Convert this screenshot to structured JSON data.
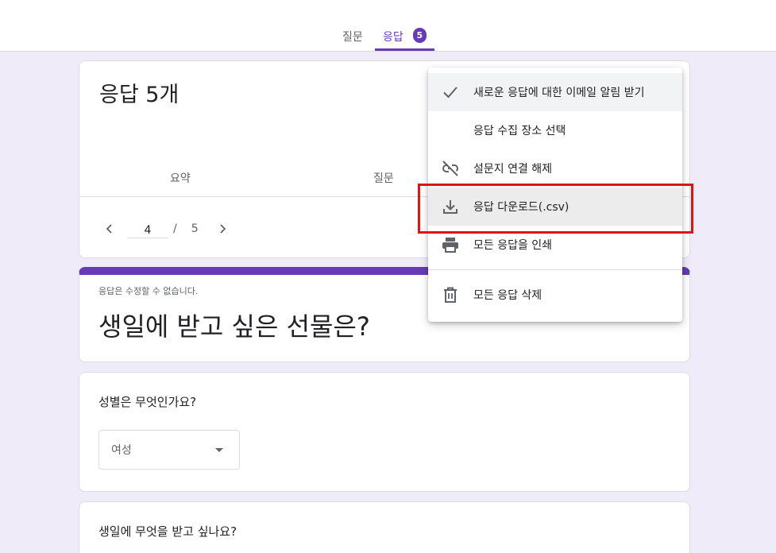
{
  "tabs": {
    "questions": "질문",
    "responses": "응답",
    "responses_count": "5"
  },
  "summary_card": {
    "response_count": "응답 5개",
    "subtabs": {
      "summary": "요약",
      "question": "질문"
    },
    "pager": {
      "current": "4",
      "separator": "/",
      "total": "5"
    }
  },
  "title_card": {
    "readonly_note": "응답은 수정할 수 없습니다.",
    "form_title": "생일에 받고 싶은 선물은?"
  },
  "question_1": {
    "label": "성별은 무엇인가요?",
    "selected": "여성"
  },
  "question_2": {
    "label": "생일에 무엇을 받고 싶나요?"
  },
  "menu": {
    "items": [
      {
        "label": "새로운 응답에 대한 이메일 알림 받기",
        "icon": "check-icon"
      },
      {
        "label": "응답 수집 장소 선택",
        "icon": ""
      },
      {
        "label": "설문지 연결 해제",
        "icon": "unlink-icon"
      },
      {
        "label": "응답 다운로드(.csv)",
        "icon": "download-icon"
      },
      {
        "label": "모든 응답을 인쇄",
        "icon": "print-icon"
      },
      {
        "label": "모든 응답 삭제",
        "icon": "trash-icon"
      }
    ]
  },
  "colors": {
    "accent": "#673ab7",
    "background": "#f0ebf8",
    "highlight_border": "#e01212"
  }
}
